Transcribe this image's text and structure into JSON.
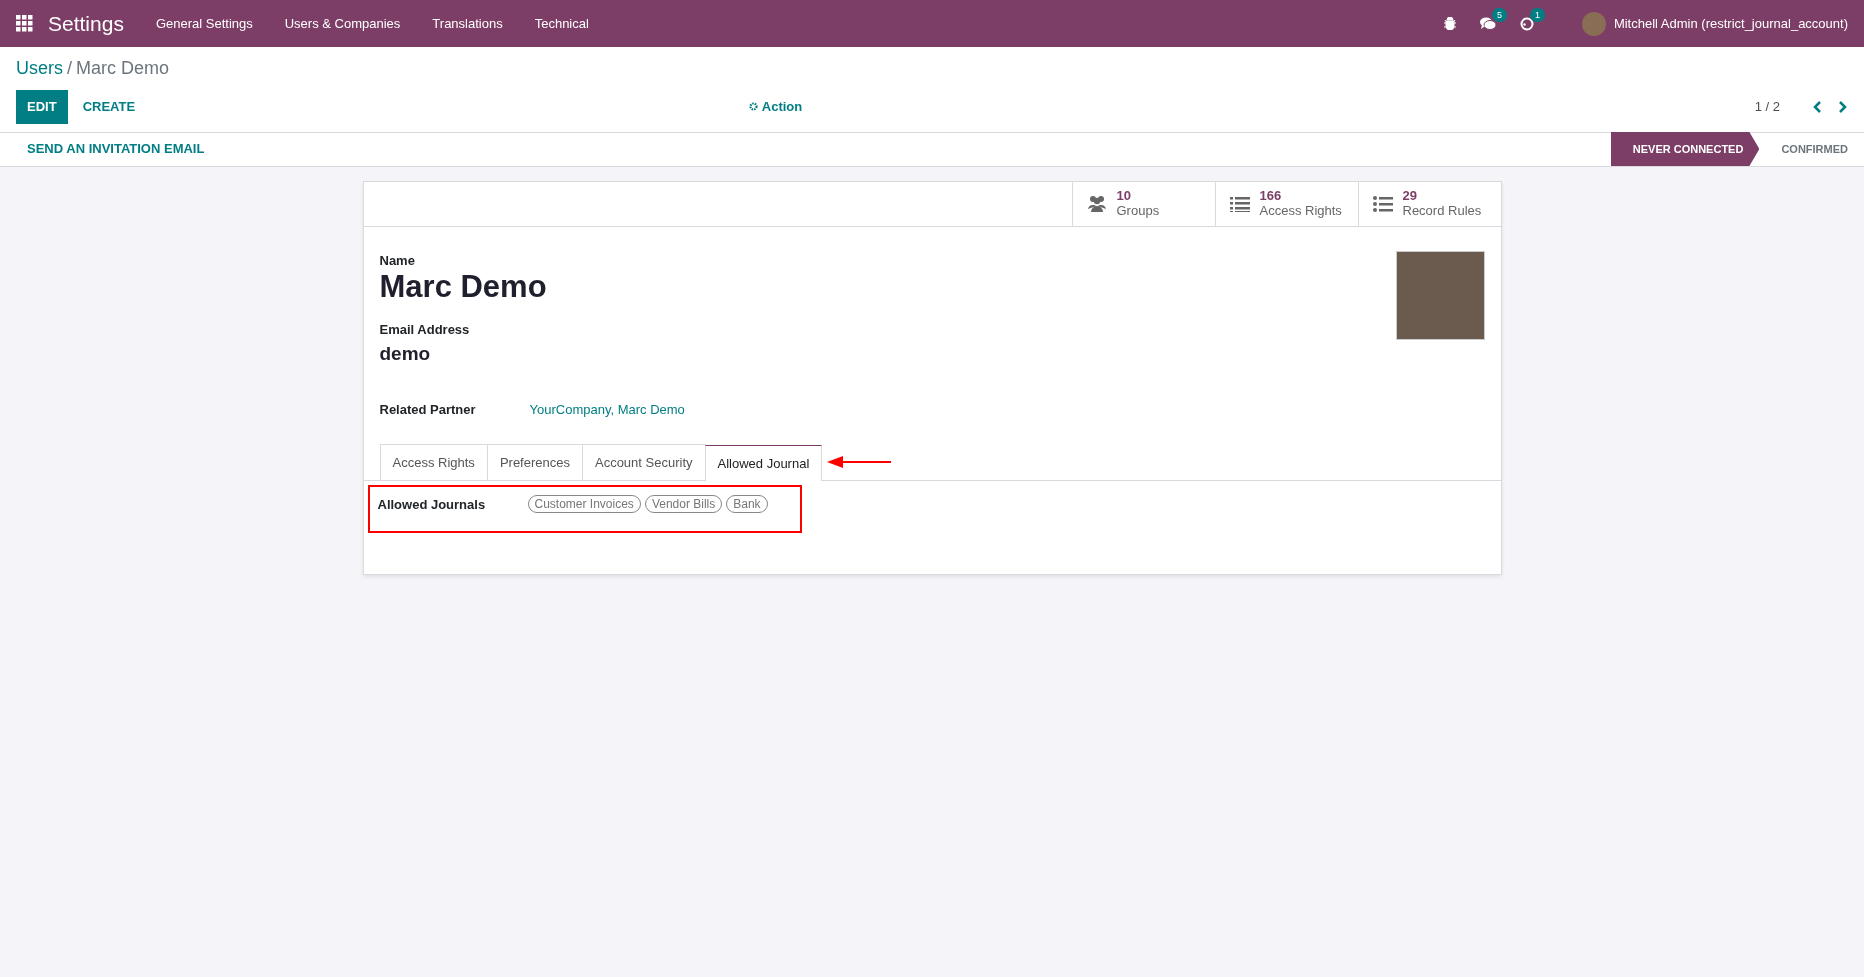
{
  "navbar": {
    "app_title": "Settings",
    "menu": [
      "General Settings",
      "Users & Companies",
      "Translations",
      "Technical"
    ],
    "messages_count": "5",
    "activities_count": "1",
    "user": "Mitchell Admin (restrict_journal_account)"
  },
  "breadcrumb": {
    "parent": "Users",
    "separator": "/",
    "current": "Marc Demo"
  },
  "control_panel": {
    "buttons": [
      {
        "label": "EDIT",
        "kind": "primary"
      },
      {
        "label": "CREATE",
        "kind": "link"
      }
    ],
    "action": "Action",
    "pager": "1 / 2"
  },
  "status_bar": {
    "button": "SEND AN INVITATION EMAIL",
    "stages": [
      {
        "label": "NEVER CONNECTED",
        "selected": true
      },
      {
        "label": "CONFIRMED",
        "selected": false
      }
    ]
  },
  "smart_buttons": [
    {
      "kind": "groups",
      "count": "10",
      "label": "Groups"
    },
    {
      "kind": "list",
      "count": "166",
      "label": "Access Rights"
    },
    {
      "kind": "bullets",
      "count": "29",
      "label": "Record Rules"
    }
  ],
  "form": {
    "name_label": "Name",
    "name": "Marc Demo",
    "email_label": "Email Address",
    "email": "demo",
    "partner_label": "Related Partner",
    "partner": "YourCompany, Marc Demo"
  },
  "tabs": [
    {
      "label": "Access Rights",
      "selected": false
    },
    {
      "label": "Preferences",
      "selected": false
    },
    {
      "label": "Account Security",
      "selected": false
    },
    {
      "label": "Allowed Journal",
      "selected": true
    }
  ],
  "allowed_journals": {
    "label": "Allowed Journals",
    "tags": [
      "Customer Invoices",
      "Vendor Bills",
      "Bank"
    ]
  }
}
